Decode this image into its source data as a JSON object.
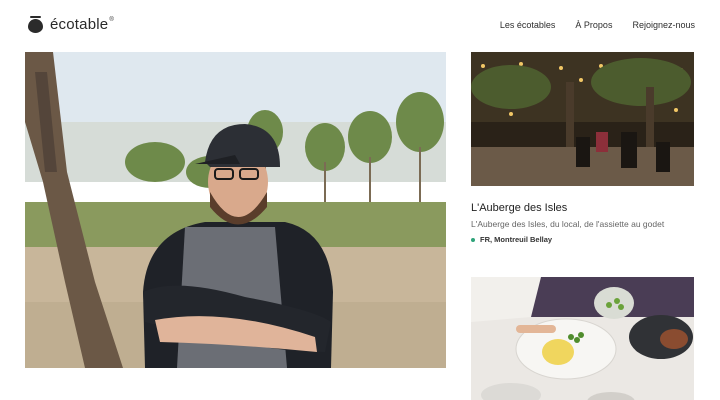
{
  "brand": {
    "name": "écotable",
    "trademark": "®"
  },
  "nav": {
    "items": [
      {
        "label": "Les écotables"
      },
      {
        "label": "À Propos"
      },
      {
        "label": "Rejoignez-nous"
      }
    ]
  },
  "hero": {
    "image": "chef-portrait-outdoors"
  },
  "cards": [
    {
      "image": "restaurant-terrace-string-lights",
      "title": "L'Auberge des Isles",
      "description": "L'Auberge des Isles, du local, de l'assiette au godet",
      "location": "FR, Montreuil Bellay"
    },
    {
      "image": "chef-plating-dish"
    }
  ],
  "colors": {
    "accent_dot": "#2fa37a",
    "text": "#222222",
    "muted": "#666666"
  }
}
